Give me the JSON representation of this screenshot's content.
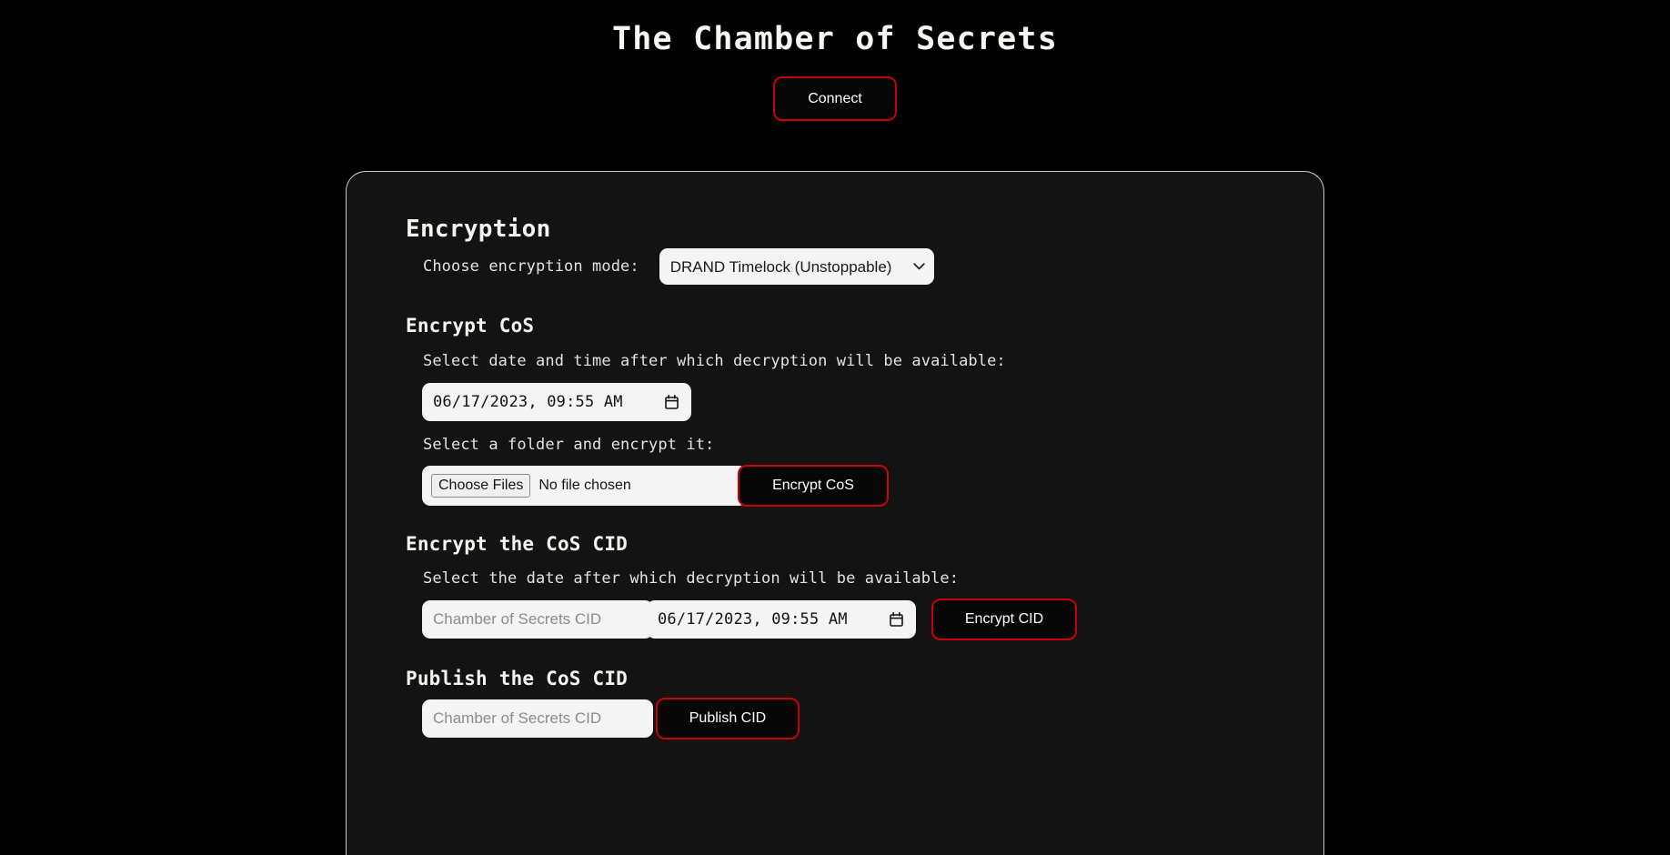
{
  "header": {
    "title": "The Chamber of Secrets",
    "connect_label": "Connect"
  },
  "card": {
    "title": "Encryption",
    "mode": {
      "label": "Choose encryption mode:",
      "selected": "DRAND Timelock (Unstoppable)",
      "options": [
        "DRAND Timelock (Unstoppable)"
      ]
    },
    "encrypt_cos": {
      "heading": "Encrypt CoS",
      "datetime_label": "Select date and time after which decryption will be available:",
      "datetime_value": "06/17/2023, 09:55 AM",
      "folder_label": "Select a folder and encrypt it:",
      "choose_files_label": "Choose Files",
      "file_status": "No file chosen",
      "button_label": "Encrypt CoS"
    },
    "encrypt_cid": {
      "heading": "Encrypt the CoS CID",
      "date_label": "Select the date after which decryption will be available:",
      "cid_placeholder": "Chamber of Secrets CID",
      "cid_value": "",
      "datetime_value": "06/17/2023, 09:55 AM",
      "button_label": "Encrypt CID"
    },
    "publish_cid": {
      "heading": "Publish the CoS CID",
      "cid_placeholder": "Chamber of Secrets CID",
      "cid_value": "",
      "button_label": "Publish CID"
    }
  },
  "colors": {
    "page_background": "#000000",
    "card_background": "#131313",
    "card_border": "#c9c9c9",
    "accent_red": "#c90007",
    "text_primary": "#f4f4ef",
    "text_label": "#e2e2e2",
    "control_background": "#f4f4f4",
    "placeholder": "#8c8c8c"
  }
}
